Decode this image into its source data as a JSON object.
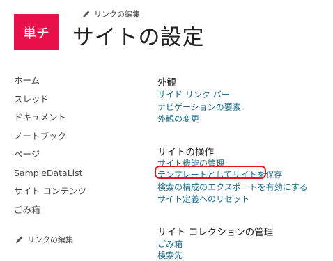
{
  "logo": {
    "text": "単チ",
    "color": "#e8104a"
  },
  "header": {
    "edit_links_label": "リンクの編集",
    "title": "サイトの設定"
  },
  "quicklaunch": {
    "items": [
      {
        "label": "ホーム"
      },
      {
        "label": "スレッド"
      },
      {
        "label": "ドキュメント"
      },
      {
        "label": "ノートブック"
      },
      {
        "label": "ページ"
      },
      {
        "label": "SampleDataList"
      },
      {
        "label": "サイト コンテンツ"
      },
      {
        "label": "ごみ箱"
      }
    ],
    "edit_links_label": "リンクの編集"
  },
  "sections": {
    "look_and_feel": {
      "title": "外観",
      "links": [
        {
          "label": "サイド リンク バー"
        },
        {
          "label": "ナビゲーションの要素"
        },
        {
          "label": "外観の変更"
        }
      ]
    },
    "site_actions": {
      "title": "サイトの操作",
      "links": [
        {
          "label": "サイト機能の管理"
        },
        {
          "label": "テンプレートとしてサイトを保存"
        },
        {
          "label": "検索の構成のエクスポートを有効にする"
        },
        {
          "label": "サイト定義へのリセット"
        }
      ]
    },
    "site_collection": {
      "title": "サイト コレクションの管理",
      "links": [
        {
          "label": "ごみ箱"
        },
        {
          "label": "検索先"
        }
      ]
    }
  },
  "colors": {
    "link": "#1b6e8e",
    "highlight": "#e2141c"
  }
}
